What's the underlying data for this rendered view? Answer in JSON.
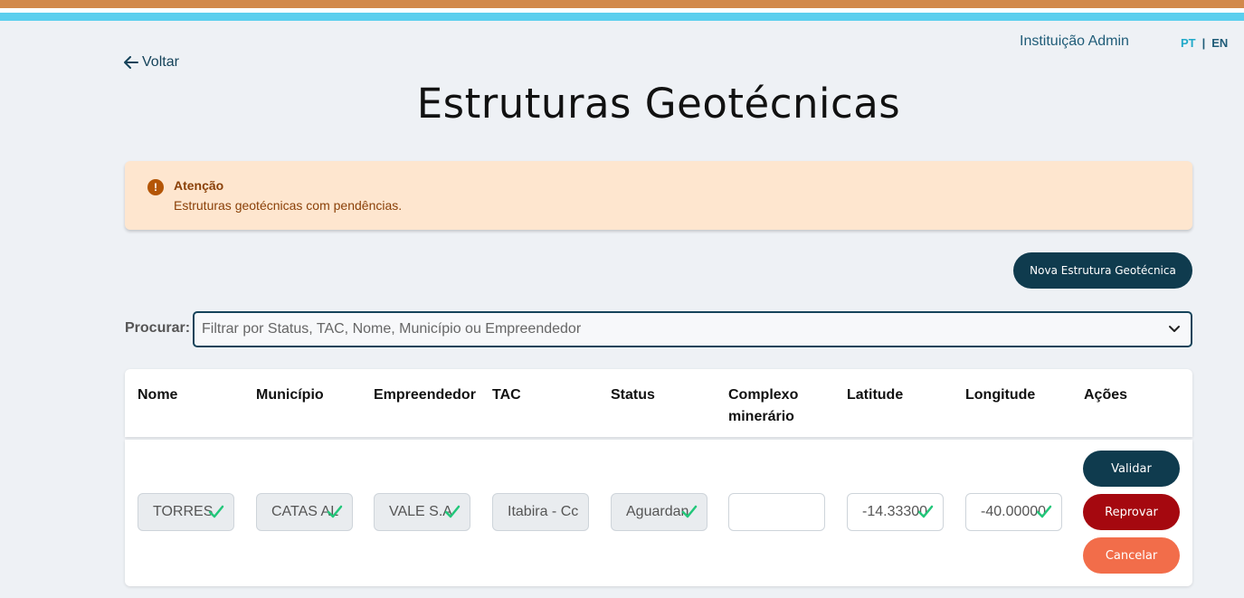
{
  "header": {
    "institution": "Instituição Admin",
    "lang_pt": "PT",
    "lang_sep": "|",
    "lang_en": "EN",
    "back_label": "Voltar",
    "back_icon": "arrow-left-icon"
  },
  "page": {
    "title": "Estruturas Geotécnicas"
  },
  "alert": {
    "icon": "exclamation-circle-icon",
    "title": "Atenção",
    "message": "Estruturas geotécnicas com pendências."
  },
  "actions": {
    "new_button": "Nova Estrutura Geotécnica"
  },
  "search": {
    "label": "Procurar:",
    "placeholder": "Filtrar por Status, TAC, Nome, Município ou Empreendedor",
    "value": ""
  },
  "table": {
    "columns": [
      "Nome",
      "Município",
      "Empreendedor",
      "TAC",
      "Status",
      "Complexo minerário",
      "Latitude",
      "Longitude",
      "Ações"
    ],
    "rows": [
      {
        "nome": "TORRES",
        "municipio": "CATAS AL",
        "empreendedor": "VALE S.A",
        "tac": "Itabira - Cc",
        "status": "Aguardan",
        "complexo": "",
        "latitude": "-14.33300",
        "longitude": "-40.00000",
        "btn_validar": "Validar",
        "btn_reprovar": "Reprovar",
        "btn_cancelar": "Cancelar"
      }
    ]
  },
  "colors": {
    "primary": "#0f3b4e",
    "danger": "#a5080f",
    "cancel": "#f26d4a",
    "alert_bg": "#fee6cf",
    "check": "#22c77a"
  }
}
